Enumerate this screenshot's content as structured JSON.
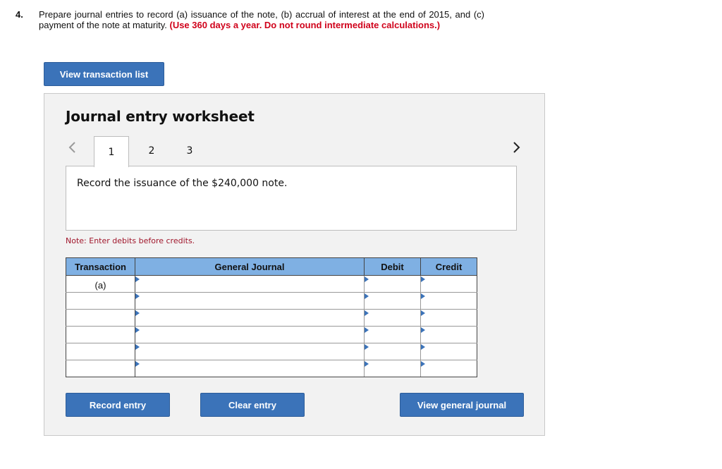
{
  "question": {
    "number": "4.",
    "text": "Prepare journal entries to record (a) issuance of the note, (b) accrual of interest at the end of 2015, and (c) payment of the note at maturity.",
    "emphasis": "(Use 360 days a year. Do not round intermediate calculations.)"
  },
  "buttons": {
    "view_transaction_list": "View transaction list",
    "record_entry": "Record entry",
    "clear_entry": "Clear entry",
    "view_general_journal": "View general journal"
  },
  "worksheet": {
    "title": "Journal entry worksheet",
    "tabs": [
      "1",
      "2",
      "3"
    ],
    "active_tab": "1",
    "instruction": "Record the issuance of the $240,000 note.",
    "note": "Note: Enter debits before credits."
  },
  "journal": {
    "headers": {
      "transaction": "Transaction",
      "general_journal": "General Journal",
      "debit": "Debit",
      "credit": "Credit"
    },
    "rows": [
      {
        "transaction": "(a)",
        "account": "",
        "debit": "",
        "credit": ""
      },
      {
        "transaction": "",
        "account": "",
        "debit": "",
        "credit": ""
      },
      {
        "transaction": "",
        "account": "",
        "debit": "",
        "credit": ""
      },
      {
        "transaction": "",
        "account": "",
        "debit": "",
        "credit": ""
      },
      {
        "transaction": "",
        "account": "",
        "debit": "",
        "credit": ""
      },
      {
        "transaction": "",
        "account": "",
        "debit": "",
        "credit": ""
      }
    ]
  },
  "colors": {
    "button_blue": "#3b73b9",
    "header_blue": "#7fb0e3",
    "emphasis_red": "#d0021b",
    "note_red": "#a0162b"
  },
  "icons": {
    "prev": "chevron-left-icon",
    "next": "chevron-right-icon",
    "dropdown": "triangle-right-icon"
  }
}
